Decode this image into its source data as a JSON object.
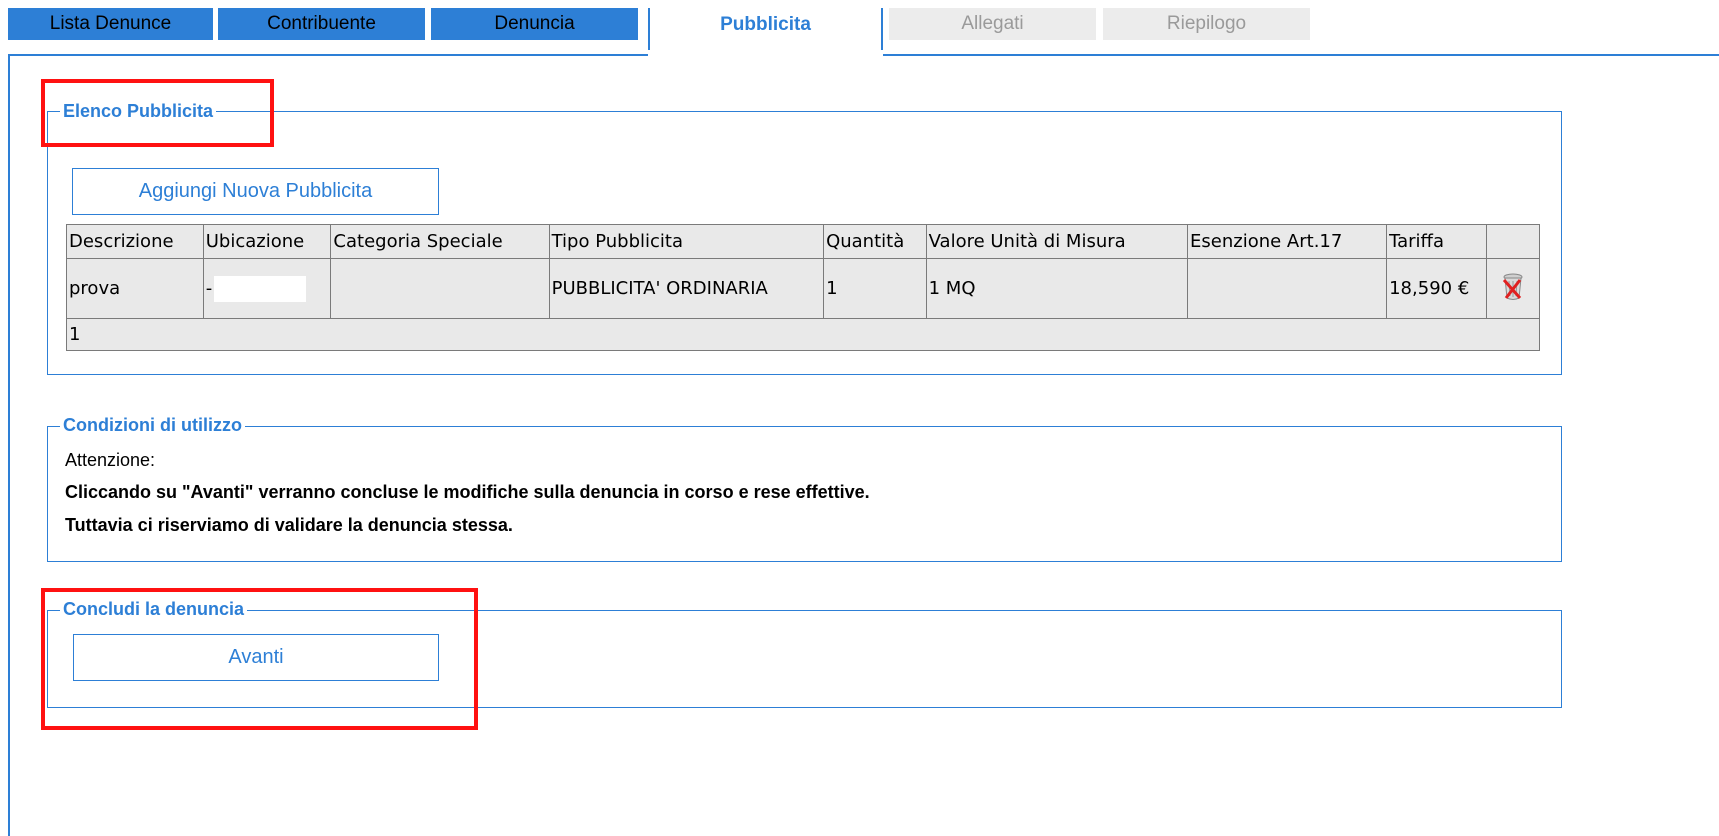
{
  "tabs": [
    {
      "label": "Lista Denunce",
      "state": "blue"
    },
    {
      "label": "Contribuente",
      "state": "blue"
    },
    {
      "label": "Denuncia",
      "state": "blue"
    },
    {
      "label": "Pubblicita",
      "state": "active"
    },
    {
      "label": "Allegati",
      "state": "disabled"
    },
    {
      "label": "Riepilogo",
      "state": "disabled"
    }
  ],
  "elenco": {
    "legend": "Elenco Pubblicita",
    "add_button": "Aggiungi Nuova Pubblicita",
    "columns": [
      "Descrizione",
      "Ubicazione",
      "Categoria Speciale",
      "Tipo Pubblicita",
      "Quantità",
      "Valore Unità di Misura",
      "Esenzione Art.17",
      "Tariffa",
      ""
    ],
    "rows": [
      {
        "descrizione": "prova",
        "ubicazione": "-",
        "categoria": "",
        "tipo": "PUBBLICITA' ORDINARIA",
        "quantita": "1",
        "valore": "1 MQ",
        "esenzione": "",
        "tariffa": "18,590 €"
      }
    ],
    "pager": "1"
  },
  "condizioni": {
    "legend": "Condizioni di utilizzo",
    "attention": "Attenzione:",
    "line1": "Cliccando su \"Avanti\" verranno concluse le modifiche sulla denuncia in corso e rese effettive.",
    "line2": "Tuttavia ci riserviamo di validare la denuncia stessa."
  },
  "concludi": {
    "legend": "Concludi la denuncia",
    "button": "Avanti"
  },
  "colors": {
    "accent": "#2d7fd6",
    "highlight": "#ff1111",
    "tab_disabled": "#ececec"
  },
  "icons": {
    "delete": "trash-delete-icon"
  }
}
